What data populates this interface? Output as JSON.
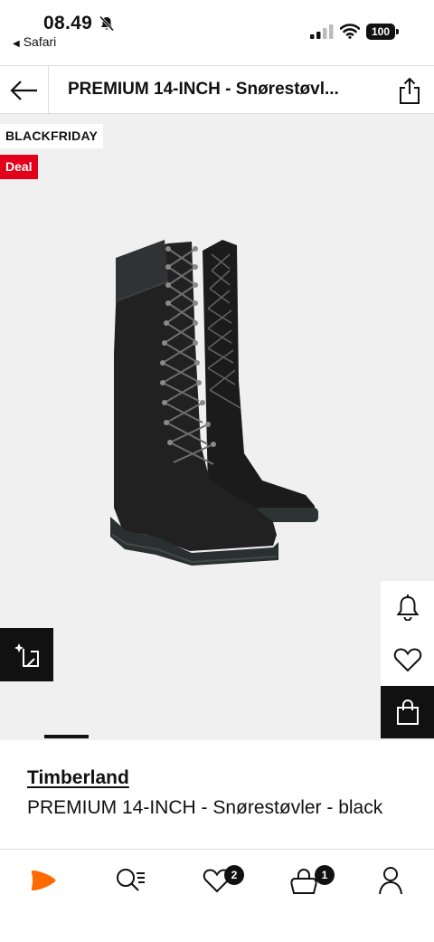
{
  "status_bar": {
    "time": "08.49",
    "back_app": "Safari",
    "battery": "100"
  },
  "header": {
    "title": "PREMIUM 14-INCH  - Snørestøvl..."
  },
  "gallery": {
    "badge_primary": "BLACKFRIDAY",
    "badge_deal": "Deal",
    "deal_color": "#e2001a"
  },
  "product": {
    "brand": "Timberland",
    "name": "PREMIUM 14-INCH  - Snørestøvler - black"
  },
  "bottom_nav": {
    "wishlist_count": "2",
    "bag_count": "1"
  },
  "colors": {
    "brand_orange": "#ff6900",
    "text": "#111111",
    "gallery_bg": "#f0f0f0"
  }
}
